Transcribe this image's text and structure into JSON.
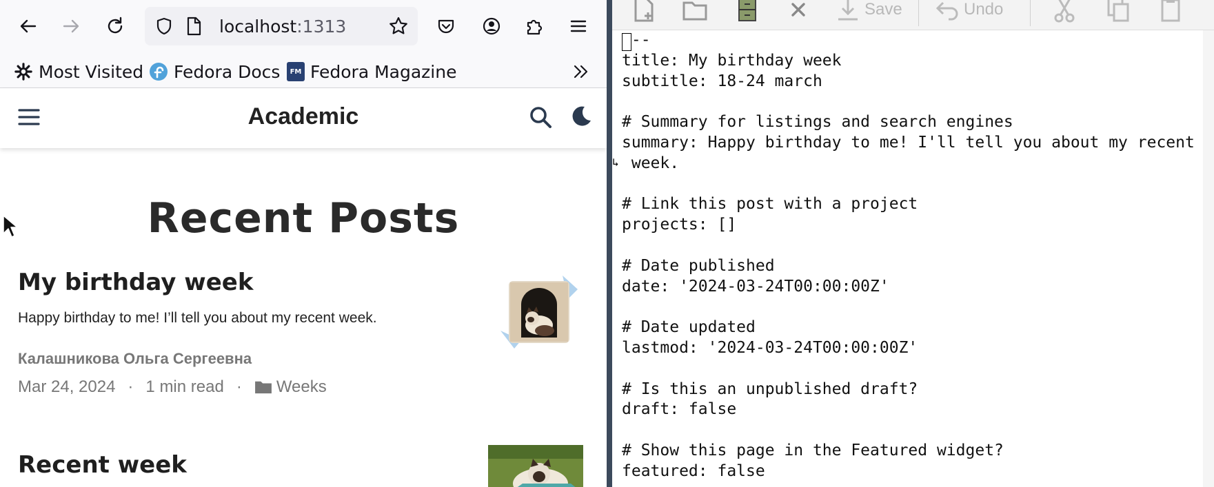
{
  "browser": {
    "url_host": "localhost",
    "url_port": ":1313",
    "bookmarks": [
      {
        "label": "Most Visited",
        "icon": "gear-icon"
      },
      {
        "label": "Fedora Docs",
        "icon": "fedora-icon"
      },
      {
        "label": "Fedora Magazine",
        "icon": "fedora-magazine-icon"
      }
    ],
    "fedora_magazine_badge": "FM"
  },
  "site": {
    "title": "Academic",
    "section_heading": "Recent Posts",
    "posts": [
      {
        "title": "My birthday week",
        "summary": "Happy birthday to me! I’ll tell you about my recent week.",
        "author": "Калашникова Ольга Сергеевна",
        "date": "Mar 24, 2024",
        "read_time": "1 min read",
        "category": "Weeks"
      },
      {
        "title": "Recent week"
      }
    ],
    "meta_separator": "·"
  },
  "editor": {
    "toolbar": {
      "save_label": "Save",
      "undo_label": "Undo"
    },
    "lines": [
      "---",
      "title: My birthday week",
      "subtitle: 18-24 march",
      "",
      "# Summary for listings and search engines",
      "summary: Happy birthday to me! I'll tell you about my recent",
      " week.",
      "",
      "# Link this post with a project",
      "projects: []",
      "",
      "# Date published",
      "date: '2024-03-24T00:00:00Z'",
      "",
      "# Date updated",
      "lastmod: '2024-03-24T00:00:00Z'",
      "",
      "# Is this an unpublished draft?",
      "draft: false",
      "",
      "# Show this page in the Featured widget?",
      "featured: false"
    ]
  },
  "colors": {
    "divider": "#3c4a5c",
    "toolbar_bg": "#f9f9fb",
    "fedora_blue": "#3c6eb4"
  }
}
